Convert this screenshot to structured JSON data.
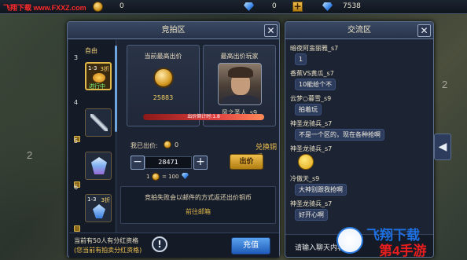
{
  "topbar": {
    "watermark": "飞翔下载 www.FXXZ.com",
    "coins_value": "0",
    "gems_value": "0",
    "gems2_value": "7538"
  },
  "background": {
    "numbers": [
      "2",
      "2"
    ]
  },
  "auction": {
    "title": "竞拍区",
    "slots": [
      {
        "index": "3",
        "badge": "自由",
        "level": "1-3",
        "sub": "进行中",
        "tag": "3折"
      },
      {
        "index": "4"
      },
      {
        "index": "5"
      },
      {
        "index": "6",
        "level": "1-3",
        "tag": "3折"
      }
    ],
    "current_bid_label": "当前最高出价",
    "current_bid_value": "25883",
    "top_player_label": "最高出价玩家",
    "top_player_name": "风之圣人_s9",
    "bar_text": "出价倒计时:1.8",
    "my_bid_label": "我已出价:",
    "my_bid_value": "0",
    "exchange_label": "兑换铜币",
    "quantity": "28471",
    "rate_left": "1",
    "rate_right": "= 100",
    "bid_button": "出价",
    "info_text": "竞拍失败会以邮件的方式返还出价铜币",
    "mail_link": "前往邮箱",
    "bottom_line1": "当前有50人有分红资格",
    "bottom_line2": "(您当前有拍卖分红资格)",
    "warn_icon": "!",
    "recharge_button": "充值"
  },
  "chat": {
    "title": "交流区",
    "messages": [
      {
        "name": "暗夜阿蛮丽雅_s7"
      },
      {
        "name": "",
        "text": "1"
      },
      {
        "name": "香蕉VS黄瓜_s7"
      },
      {
        "name": "",
        "text": "10能给个不"
      },
      {
        "name": "云梦○暮雪_s9"
      },
      {
        "name": "",
        "text": "拍着玩"
      },
      {
        "name": "神圣龙骑兵_s7"
      },
      {
        "name": "",
        "text": "不是一个区的，现在各种抢啊"
      },
      {
        "name": "神圣龙骑兵_s7"
      },
      {
        "name": "",
        "emoji": true
      },
      {
        "name": "冷傲天_s9"
      },
      {
        "name": "",
        "text": "大神别跟我抢啊"
      },
      {
        "name": "神圣龙骑兵_s7"
      },
      {
        "name": "",
        "text": "好开心啊"
      }
    ],
    "input_placeholder": "请输入聊天内容"
  },
  "logo": {
    "line1": "飞翔下载",
    "line2": "第4手游"
  },
  "colors": {
    "gold": "#e1b84a",
    "panel": "#1c2433",
    "accent_blue": "#3a86e8",
    "red_bar": "#e04040"
  }
}
